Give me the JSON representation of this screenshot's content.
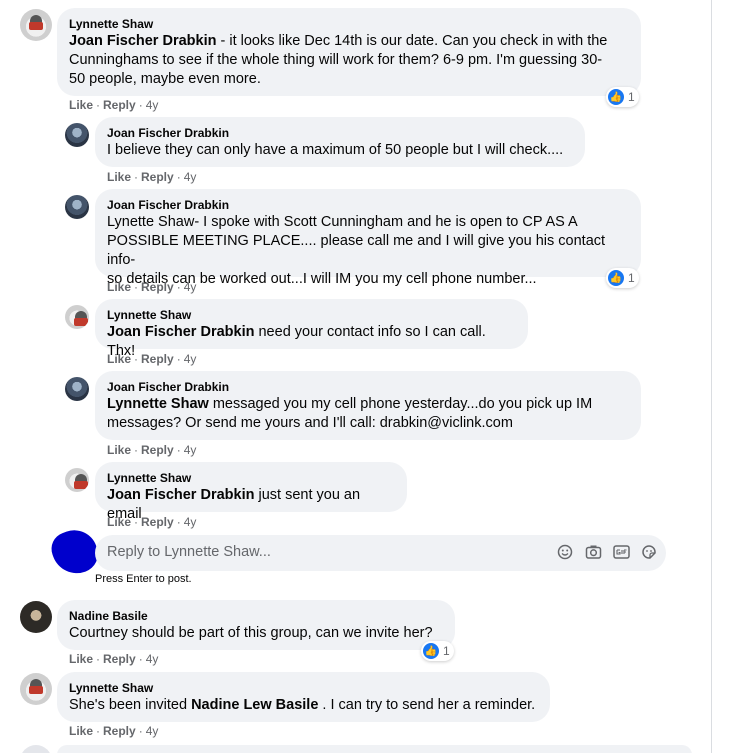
{
  "comments": [
    {
      "author": "Lynnette Shaw",
      "mention": "Joan Fischer Drabkin",
      "text": " - it looks like Dec 14th is our date. Can you check in with the\nCunninghams to see if the whole thing will work for them? 6-9 pm. I'm guessing 30-\n50 people, maybe even more.",
      "like": "Like",
      "reply": "Reply",
      "time": "4y",
      "reactions": "1"
    },
    {
      "author": "Joan Fischer Drabkin",
      "mention": "",
      "text": "I believe they can only have a maximum of 50 people but I will check....",
      "like": "Like",
      "reply": "Reply",
      "time": "4y"
    },
    {
      "author": "Joan Fischer Drabkin",
      "mention": "",
      "text": "Lynette Shaw- I spoke with Scott Cunningham and he is open to CP AS A\nPOSSIBLE MEETING PLACE.... please call me and I will give you his contact info-\nso details can be worked out...I will IM you my cell phone number...",
      "like": "Like",
      "reply": "Reply",
      "time": "4y",
      "reactions": "1"
    },
    {
      "author": "Lynnette Shaw",
      "mention": "Joan Fischer Drabkin",
      "text": " need your contact info so I can call. Thx!",
      "like": "Like",
      "reply": "Reply",
      "time": "4y"
    },
    {
      "author": "Joan Fischer Drabkin",
      "mention": "Lynnette Shaw",
      "text": " messaged you my cell phone yesterday...do you pick up IM\nmessages? Or send me yours and I'll call: drabkin@viclink.com",
      "like": "Like",
      "reply": "Reply",
      "time": "4y"
    },
    {
      "author": "Lynnette Shaw",
      "mention": "Joan Fischer Drabkin",
      "text": " just sent you an email",
      "like": "Like",
      "reply": "Reply",
      "time": "4y"
    },
    {
      "author": "Nadine Basile",
      "mention": "",
      "text": "Courtney should be part of this group, can we invite her?",
      "like": "Like",
      "reply": "Reply",
      "time": "4y",
      "reactions": "1"
    },
    {
      "author": "Lynnette Shaw",
      "pre": "She's been invited ",
      "mention": "Nadine Lew Basile",
      "text": " . I can try to send her a reminder.",
      "like": "Like",
      "reply": "Reply",
      "time": "4y"
    }
  ],
  "reply_box": {
    "placeholder": "Reply to Lynnette Shaw...",
    "hint": "Press Enter to post.",
    "icons": [
      "emoji-icon",
      "camera-icon",
      "gif-icon",
      "sticker-icon"
    ]
  },
  "colors": {
    "bubble": "#f0f2f5",
    "like_blue": "#1877f2",
    "meta_gray": "#65676b"
  }
}
